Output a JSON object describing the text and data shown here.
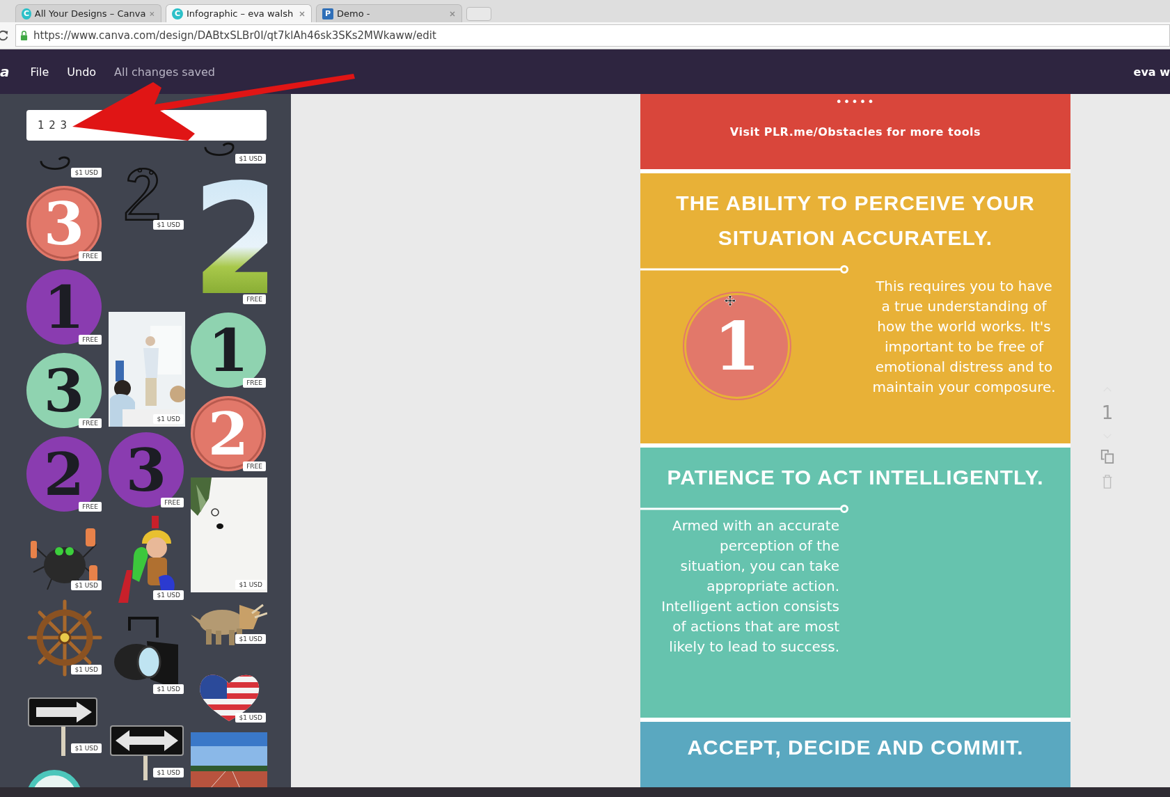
{
  "browser": {
    "tabs": [
      {
        "title": "All Your Designs – Canva",
        "icon": "C",
        "selected": false
      },
      {
        "title": "Infographic – eva walsh",
        "icon": "C",
        "selected": true
      },
      {
        "title": "Demo -",
        "icon": "P",
        "selected": false
      }
    ],
    "url": "https://www.canva.com/design/DABtxSLBr0I/qt7klAh46sk3SKs2MWkaww/edit"
  },
  "topbar": {
    "logo": "a",
    "menu": [
      "File",
      "Undo"
    ],
    "status": "All changes saved",
    "user": "eva w"
  },
  "sidebar": {
    "search": {
      "value": "1 2 3"
    },
    "columns": [
      {
        "items": [
          {
            "kind": "doodle",
            "price": "$1 USD"
          },
          {
            "kind": "digit-circle",
            "digit": "3",
            "color": "#e2786a",
            "ring": true,
            "price": "FREE"
          },
          {
            "kind": "digit-circle",
            "digit": "1",
            "color": "#8a3cb0",
            "ring": false,
            "price": "FREE"
          },
          {
            "kind": "digit-circle",
            "digit": "3",
            "color": "#8fd3b0",
            "ring": false,
            "price": "FREE"
          },
          {
            "kind": "digit-circle",
            "digit": "2",
            "color": "#8a3cb0",
            "ring": false,
            "price": "FREE"
          },
          {
            "kind": "spider",
            "price": "$1 USD"
          },
          {
            "kind": "wheel",
            "price": "$1 USD"
          },
          {
            "kind": "arrow-sign",
            "price": "$1 USD"
          },
          {
            "kind": "teal-sticker"
          }
        ]
      },
      {
        "items": [
          {
            "kind": "doodle-tall",
            "price": "$1 USD"
          },
          {
            "kind": "office-photo",
            "price": "$1 USD"
          },
          {
            "kind": "digit-circle",
            "digit": "3",
            "color": "#8a3cb0",
            "ring": false,
            "price": "FREE"
          },
          {
            "kind": "soldier",
            "price": "$1 USD"
          },
          {
            "kind": "spotlight",
            "price": "$1 USD"
          },
          {
            "kind": "double-arrow-sign",
            "price": "$1 USD"
          }
        ]
      },
      {
        "items": [
          {
            "kind": "doodle",
            "price": "$1 USD"
          },
          {
            "kind": "sky-digit",
            "digit": "2",
            "price": "FREE"
          },
          {
            "kind": "digit-circle",
            "digit": "1",
            "color": "#8fd3b0",
            "ring": false,
            "price": "FREE"
          },
          {
            "kind": "digit-circle",
            "digit": "2",
            "color": "#e2786a",
            "ring": true,
            "price": "FREE"
          },
          {
            "kind": "still-photo",
            "price": "$1 USD"
          },
          {
            "kind": "dinosaur",
            "price": "$1 USD"
          },
          {
            "kind": "flag-heart",
            "price": "$1 USD"
          },
          {
            "kind": "track-photo"
          }
        ]
      }
    ]
  },
  "design": {
    "sections": [
      {
        "kind": "footer",
        "color": "#d9463b",
        "dots": "•••••",
        "text": "Visit PLR.me/Obstacles for more tools"
      },
      {
        "kind": "step",
        "color": "#e8b137",
        "heading": "THE ABILITY TO PERCEIVE YOUR SITUATION ACCURATELY.",
        "number": "1",
        "body": "This requires you to have a true understanding of how the world works. It's important to be free of emotional distress and to maintain your composure."
      },
      {
        "kind": "step",
        "color": "#66c3ae",
        "heading": "PATIENCE TO ACT INTELLIGENTLY.",
        "body": "Armed with an accurate perception of the situation, you can take appropriate action. Intelligent action consists of actions that are most likely to lead to success."
      },
      {
        "kind": "heading",
        "color": "#5aa8c0",
        "heading": "ACCEPT, DECIDE AND COMMIT."
      }
    ]
  },
  "page_controls": {
    "page_number": "1"
  }
}
